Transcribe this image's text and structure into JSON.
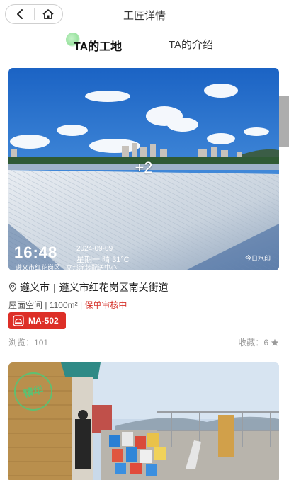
{
  "header": {
    "title": "工匠详情"
  },
  "tabs": [
    {
      "label": "TA的工地",
      "active": true
    },
    {
      "label": "TA的介绍",
      "active": false
    }
  ],
  "works": [
    {
      "image_count_overlay": "+2",
      "photo_stamp": {
        "time": "16:48",
        "date": "2024-09-09",
        "weather": "星期一 晴 31°C",
        "address": "遵义市红花岗区 · 立邦涂装配送中心",
        "logo": "今日水印"
      },
      "city": "遵义市",
      "address": "遵义市红花岗区南关街道",
      "space": "屋面空间",
      "area": "1100m²",
      "status": "保单审核中",
      "badge_code": "MA-502",
      "views_label": "浏览：",
      "views": "101",
      "favorites_label": "收藏：",
      "favorites": "6"
    },
    {
      "watermark": "精华"
    }
  ],
  "colors": {
    "accent_red": "#dd2f27",
    "tab_indicator": "#9be3a1"
  }
}
